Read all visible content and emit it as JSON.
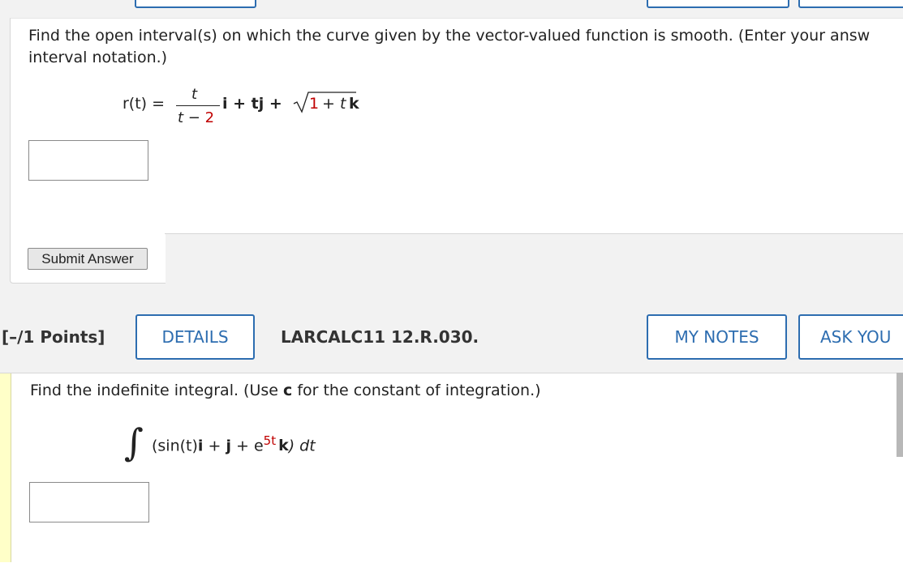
{
  "q1": {
    "prompt_line1": "Find the open interval(s) on which the curve given by the vector-valued function is smooth. (Enter your answ",
    "prompt_line2": "interval notation.)",
    "func_lhs": "r(t) =",
    "frac_num": "t",
    "frac_den_t": "t −",
    "frac_den_2": "2",
    "func_mid": "i + tj +",
    "sqrt_one": "1",
    "sqrt_rest": "+ t",
    "func_k": "k",
    "answer_value": "",
    "submit_label": "Submit Answer"
  },
  "q2": {
    "points": "[–/1 Points]",
    "details_label": "DETAILS",
    "question_id": "LARCALC11 12.R.030.",
    "my_notes_label": "MY NOTES",
    "ask_label": "ASK YOU",
    "prompt_pre": "Find the indefinite integral. (Use ",
    "prompt_c": "c",
    "prompt_post": " for the constant of integration.)",
    "integral_sign": "∫",
    "integrand_pre": "(sin(t)",
    "integrand_i": "i",
    "integrand_mid1": " + ",
    "integrand_j": "j",
    "integrand_mid2": " + e",
    "exponent": "5t",
    "integrand_k": "k",
    "integrand_end": ") dt",
    "answer_value": ""
  },
  "colors": {
    "accent": "#2d6db0",
    "highlight": "#ffffc8",
    "red": "#c00000"
  }
}
